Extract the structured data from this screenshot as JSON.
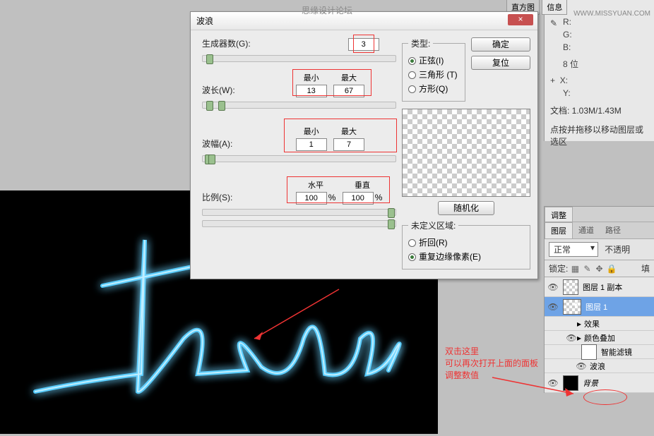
{
  "watermark": "思缘设计论坛",
  "watermark_url": "WWW.MISSYUAN.COM",
  "dialog": {
    "title": "波浪",
    "close": "×",
    "generators_label": "生成器数(G):",
    "generators_value": "3",
    "wavelength_label": "波长(W):",
    "min_label": "最小",
    "max_label": "最大",
    "wavelength_min": "13",
    "wavelength_max": "67",
    "amplitude_label": "波幅(A):",
    "amplitude_min": "1",
    "amplitude_max": "7",
    "scale_label": "比例(S):",
    "horiz_label": "水平",
    "vert_label": "垂直",
    "scale_h": "100",
    "scale_v": "100",
    "pct": "%",
    "type_legend": "类型:",
    "type_sine": "正弦(I)",
    "type_tri": "三角形 (T)",
    "type_square": "方形(Q)",
    "ok": "确定",
    "cancel": "复位",
    "randomize": "随机化",
    "undefined_legend": "未定义区域:",
    "wrap": "折回(R)",
    "repeat": "重复边缘像素(E)"
  },
  "info": {
    "tab1": "直方图",
    "tab2": "信息",
    "r": "R:",
    "g": "G:",
    "b": "B:",
    "bits": "8 位",
    "x": "X:",
    "y": "Y:",
    "doc": "文档: 1.03M/1.43M",
    "hint": "点按并拖移以移动图层或选区"
  },
  "panels": {
    "adjust_tab": "调整",
    "layers": "图层",
    "channels": "通道",
    "paths": "路径",
    "blend": "正常",
    "opacity": "不透明",
    "lock_label": "锁定:",
    "fill_label": "填"
  },
  "layers": [
    {
      "name": "图层 1 副本",
      "thumb": "check",
      "vis": true
    },
    {
      "name": "图层 1",
      "thumb": "check",
      "vis": true,
      "selected": true
    },
    {
      "name": "效果",
      "sub": true
    },
    {
      "name": "颜色叠加",
      "sub": true,
      "vis": true
    },
    {
      "name": "智能滤镜",
      "sub": true,
      "thumb": "white"
    },
    {
      "name": "波浪",
      "sub2": true,
      "vis": true
    },
    {
      "name": "背景",
      "thumb": "black",
      "vis": true,
      "italic": true
    }
  ],
  "anno": {
    "l1": "双击这里",
    "l2": "可以再次打开上面的面板",
    "l3": "调整数值"
  }
}
